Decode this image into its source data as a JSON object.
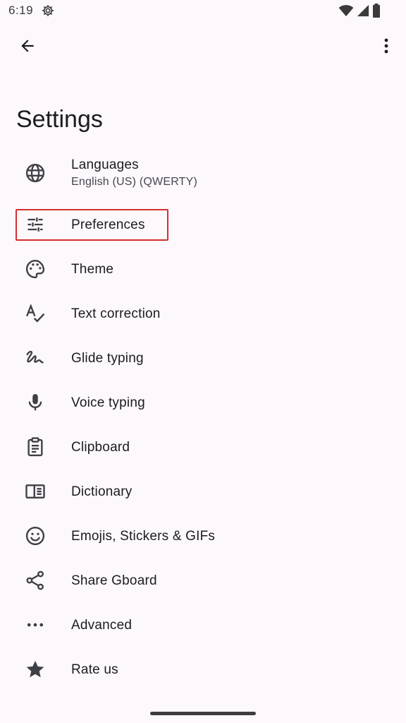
{
  "status_bar": {
    "time": "6:19",
    "icons": [
      "settings-gear-icon",
      "wifi-icon",
      "cell-signal-icon",
      "battery-icon"
    ]
  },
  "top_bar": {
    "back_icon": "arrow-back-icon",
    "more_icon": "more-vert-icon"
  },
  "page": {
    "title": "Settings"
  },
  "settings": [
    {
      "id": "languages",
      "label": "Languages",
      "sublabel": "English (US) (QWERTY)",
      "icon": "globe-icon"
    },
    {
      "id": "preferences",
      "label": "Preferences",
      "icon": "tune-icon",
      "highlighted": true
    },
    {
      "id": "theme",
      "label": "Theme",
      "icon": "palette-icon"
    },
    {
      "id": "text-correction",
      "label": "Text correction",
      "icon": "spellcheck-icon"
    },
    {
      "id": "glide-typing",
      "label": "Glide typing",
      "icon": "gesture-icon"
    },
    {
      "id": "voice-typing",
      "label": "Voice typing",
      "icon": "mic-icon"
    },
    {
      "id": "clipboard",
      "label": "Clipboard",
      "icon": "clipboard-icon"
    },
    {
      "id": "dictionary",
      "label": "Dictionary",
      "icon": "book-icon"
    },
    {
      "id": "emojis",
      "label": "Emojis, Stickers & GIFs",
      "icon": "emoji-icon"
    },
    {
      "id": "share",
      "label": "Share Gboard",
      "icon": "share-icon"
    },
    {
      "id": "advanced",
      "label": "Advanced",
      "icon": "more-horiz-icon"
    },
    {
      "id": "rate",
      "label": "Rate us",
      "icon": "star-icon"
    }
  ],
  "colors": {
    "background": "#fdf8fc",
    "text": "#1d1b20",
    "secondary_text": "#49454f",
    "highlight": "#d32f2f"
  }
}
